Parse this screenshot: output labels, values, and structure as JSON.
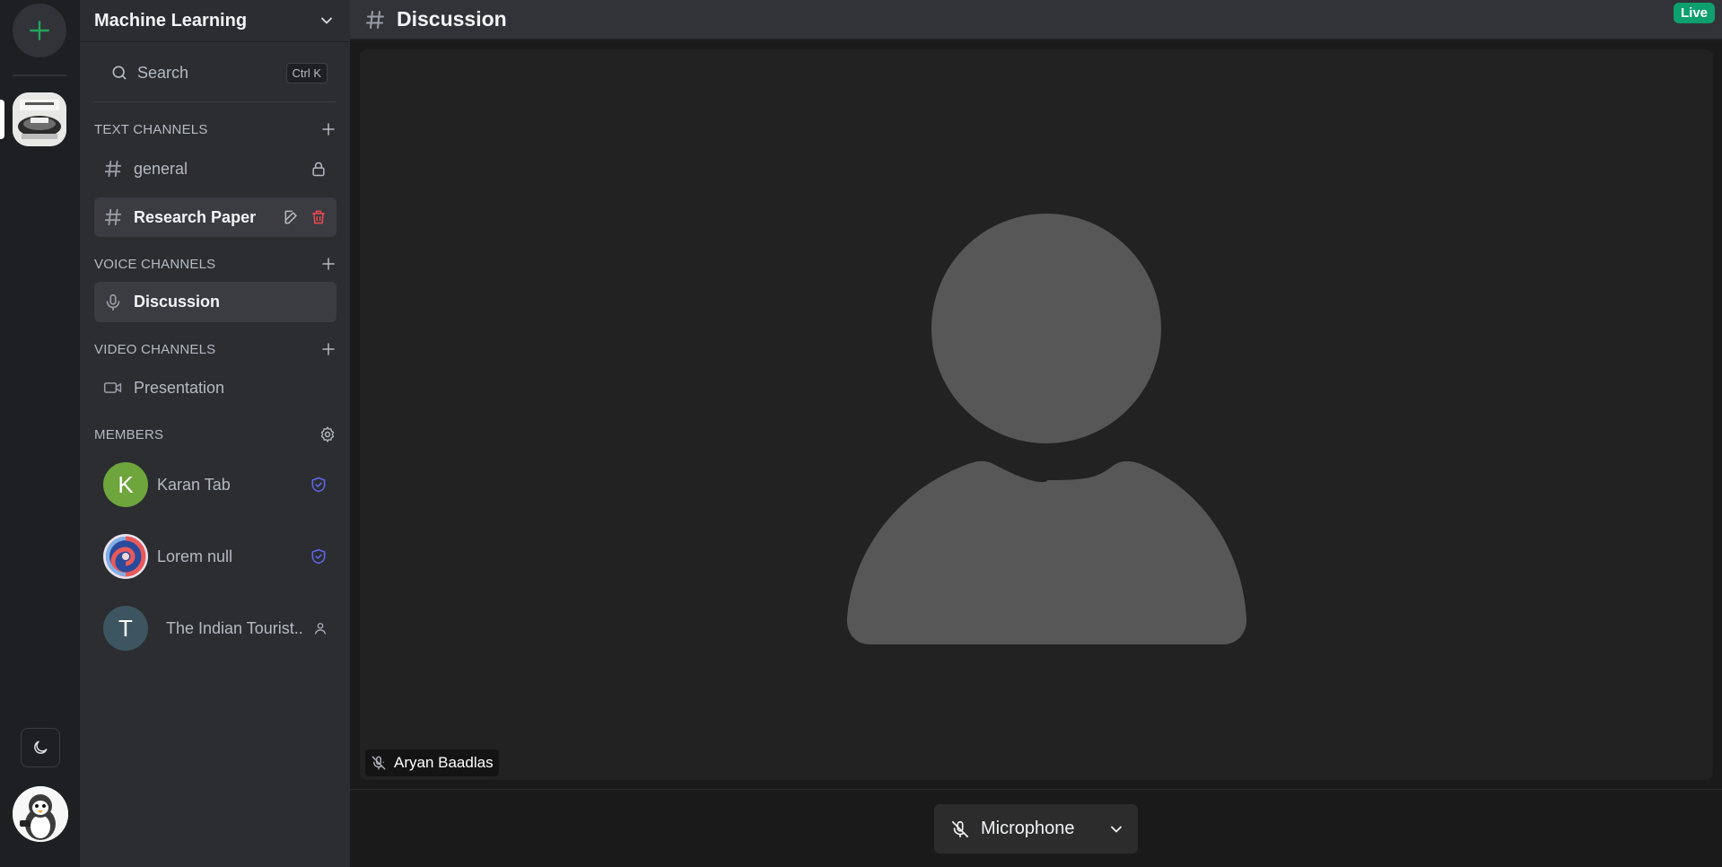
{
  "rail": {
    "add_icon": "plus-icon",
    "server_icon": "server-icon-machine-learning",
    "theme_icon": "moon-icon",
    "user_avatar": "penguin-avatar"
  },
  "sidebar": {
    "server_name": "Machine Learning",
    "search": {
      "label": "Search",
      "shortcut": "Ctrl K"
    },
    "text_channels": {
      "label": "TEXT CHANNELS",
      "items": [
        {
          "label": "general",
          "icon": "hash-icon",
          "trailing": "lock-icon"
        },
        {
          "label": "Research Paper",
          "icon": "hash-icon",
          "trailing": "edit-delete"
        }
      ]
    },
    "voice_channels": {
      "label": "VOICE CHANNELS",
      "items": [
        {
          "label": "Discussion",
          "icon": "mic-icon"
        }
      ]
    },
    "video_channels": {
      "label": "VIDEO CHANNELS",
      "items": [
        {
          "label": "Presentation",
          "icon": "video-icon"
        }
      ]
    },
    "members": {
      "label": "MEMBERS",
      "items": [
        {
          "name": "Karan Tab",
          "initial": "K",
          "role": "moderator",
          "avatar_color": "#6ea53c"
        },
        {
          "name": "Lorem null",
          "initial": "",
          "role": "moderator",
          "avatar_color": "#3a5ba8"
        },
        {
          "name": "The Indian Tourist..",
          "initial": "T",
          "role": "guest",
          "avatar_color": "#3d5560"
        }
      ]
    }
  },
  "main": {
    "channel_title": "Discussion",
    "live_badge": "Live",
    "participant": {
      "name": "Aryan Baadlas",
      "muted": true
    },
    "controls": {
      "microphone_label": "Microphone"
    }
  },
  "colors": {
    "accent_green": "#23a55a",
    "live_green": "#0e9f6e",
    "moderator_icon": "#6366f1",
    "delete_red": "#f04752"
  }
}
